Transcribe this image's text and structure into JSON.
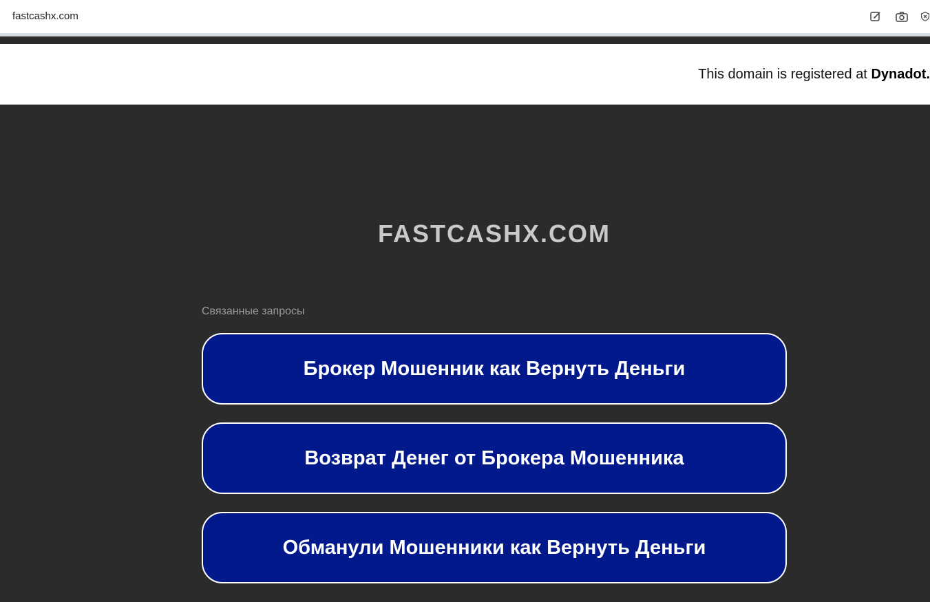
{
  "browser": {
    "url": "fastcashx.com",
    "icons": [
      "edit-icon",
      "camera-icon",
      "shield-close-icon"
    ]
  },
  "registration": {
    "prefix": "This domain is registered at ",
    "registrar": "Dynadot."
  },
  "site": {
    "title": "FASTCASHX.COM"
  },
  "related": {
    "label": "Связанные запросы",
    "links": [
      "Брокер Мошенник как Вернуть Деньги",
      "Возврат Денег от Брокера Мошенника",
      "Обманули Мошенники как Вернуть Деньги"
    ]
  },
  "colors": {
    "background": "#2b2b2b",
    "button": "#02198b",
    "title": "#c9c9c9"
  }
}
